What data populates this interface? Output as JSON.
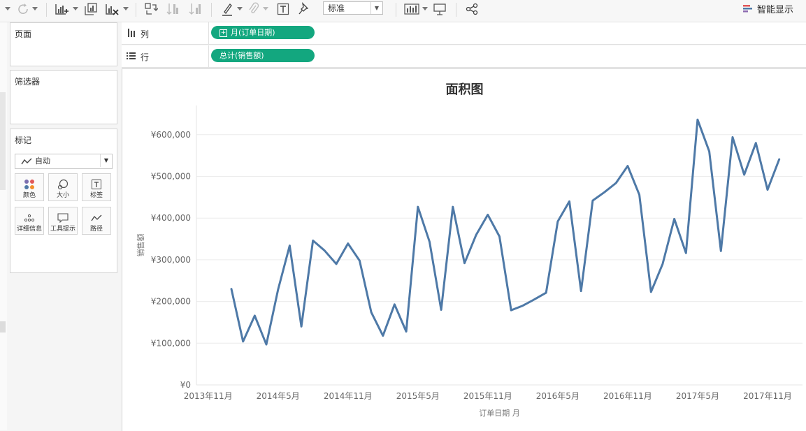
{
  "toolbar": {
    "mark_type_select": "标准",
    "show_me_label": "智能显示"
  },
  "panels": {
    "pages": "页面",
    "filters": "筛选器",
    "marks": "标记",
    "marks_type": "自动",
    "mark_buttons": {
      "color": "颜色",
      "size": "大小",
      "label": "标签",
      "detail": "详细信息",
      "tooltip": "工具提示",
      "path": "路径"
    }
  },
  "shelves": {
    "columns_label": "列",
    "columns_pill": "月(订单日期)",
    "rows_label": "行",
    "rows_pill": "总计(销售额)"
  },
  "chart_data": {
    "type": "line",
    "title": "面积图",
    "xlabel": "订单日期 月",
    "ylabel": "销售额",
    "ylim": [
      0,
      670000
    ],
    "yticks": [
      0,
      100000,
      200000,
      300000,
      400000,
      500000,
      600000
    ],
    "ytick_labels": [
      "¥0",
      "¥100,000",
      "¥200,000",
      "¥300,000",
      "¥400,000",
      "¥500,000",
      "¥600,000"
    ],
    "xtick_labels": [
      {
        "label": "2013年11月",
        "month": "2013-11"
      },
      {
        "label": "2014年5月",
        "month": "2014-05"
      },
      {
        "label": "2014年11月",
        "month": "2014-11"
      },
      {
        "label": "2015年5月",
        "month": "2015-05"
      },
      {
        "label": "2015年11月",
        "month": "2015-11"
      },
      {
        "label": "2016年5月",
        "month": "2016-05"
      },
      {
        "label": "2016年11月",
        "month": "2016-11"
      },
      {
        "label": "2017年5月",
        "month": "2017-05"
      },
      {
        "label": "2017年11月",
        "month": "2017-11"
      }
    ],
    "color": "#4e79a7",
    "series": [
      {
        "name": "销售额",
        "x": [
          "2014-01",
          "2014-02",
          "2014-03",
          "2014-04",
          "2014-05",
          "2014-06",
          "2014-07",
          "2014-08",
          "2014-09",
          "2014-10",
          "2014-11",
          "2014-12",
          "2015-01",
          "2015-02",
          "2015-03",
          "2015-04",
          "2015-05",
          "2015-06",
          "2015-07",
          "2015-08",
          "2015-09",
          "2015-10",
          "2015-11",
          "2015-12",
          "2016-01",
          "2016-02",
          "2016-03",
          "2016-04",
          "2016-05",
          "2016-06",
          "2016-07",
          "2016-08",
          "2016-09",
          "2016-10",
          "2016-11",
          "2016-12",
          "2017-01",
          "2017-02",
          "2017-03",
          "2017-04",
          "2017-05",
          "2017-06",
          "2017-07",
          "2017-08",
          "2017-09",
          "2017-10",
          "2017-11",
          "2017-12"
        ],
        "values": [
          230000,
          104000,
          166000,
          97000,
          228000,
          334000,
          140000,
          346000,
          322000,
          290000,
          339000,
          298000,
          174000,
          118000,
          193000,
          128000,
          427000,
          343000,
          180000,
          427000,
          292000,
          360000,
          408000,
          356000,
          179000,
          190000,
          205000,
          221000,
          392000,
          440000,
          225000,
          442000,
          462000,
          484000,
          525000,
          456000,
          223000,
          290000,
          398000,
          316000,
          636000,
          560000,
          321000,
          594000,
          504000,
          580000,
          468000,
          541000
        ]
      }
    ]
  }
}
